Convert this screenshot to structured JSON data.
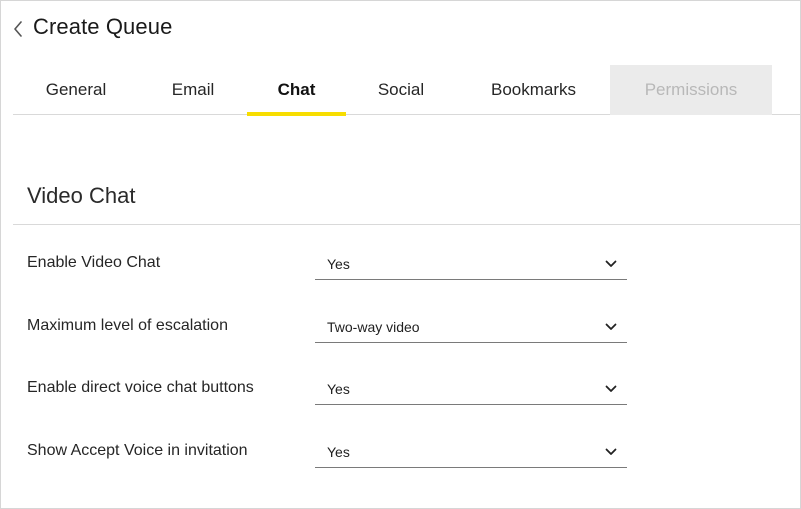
{
  "header": {
    "title": "Create Queue"
  },
  "tabs": [
    {
      "label": "General",
      "state": "normal"
    },
    {
      "label": "Email",
      "state": "normal"
    },
    {
      "label": "Chat",
      "state": "active"
    },
    {
      "label": "Social",
      "state": "normal"
    },
    {
      "label": "Bookmarks",
      "state": "normal"
    },
    {
      "label": "Permissions",
      "state": "disabled"
    }
  ],
  "accent_color": "#f7dd00",
  "section": {
    "title": "Video Chat",
    "fields": [
      {
        "label": "Enable Video Chat",
        "value": "Yes"
      },
      {
        "label": "Maximum level of escalation",
        "value": "Two-way video"
      },
      {
        "label": "Enable direct voice chat buttons",
        "value": "Yes"
      },
      {
        "label": "Show Accept Voice in invitation",
        "value": "Yes"
      }
    ]
  },
  "icons": {
    "back": "chevron-left-icon",
    "dropdown": "chevron-down-icon"
  }
}
